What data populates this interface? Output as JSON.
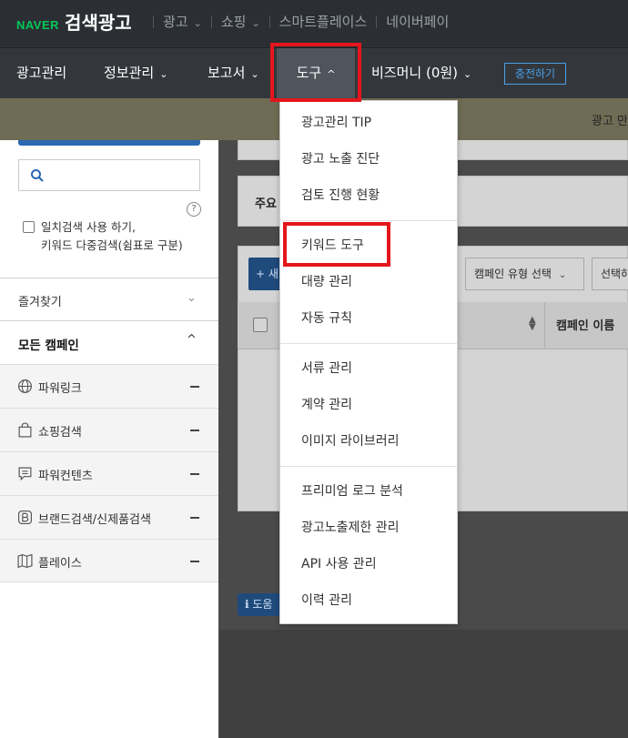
{
  "header": {
    "brand_naver": "NAVER",
    "brand_title": "검색광고",
    "top_links": [
      {
        "label": "광고",
        "has_chevron": true
      },
      {
        "label": "쇼핑",
        "has_chevron": true
      },
      {
        "label": "스마트플레이스",
        "has_chevron": false
      },
      {
        "label": "네이버페이",
        "has_chevron": false
      }
    ]
  },
  "nav": {
    "items": [
      {
        "label": "광고관리",
        "chevron": ""
      },
      {
        "label": "정보관리",
        "chevron": "⌄"
      },
      {
        "label": "보고서",
        "chevron": "⌄"
      },
      {
        "label": "도구",
        "chevron": "^"
      },
      {
        "label": "비즈머니 (0원)",
        "chevron": "⌄"
      }
    ],
    "charge_button": "충전하기"
  },
  "notice": {
    "text": "광고 만"
  },
  "sidebar": {
    "exact_search_label_line1": "일치검색 사용 하기,",
    "exact_search_label_line2": "키워드 다중검색(쉼표로 구분)",
    "help_glyph": "?",
    "favorites_label": "즐겨찾기",
    "all_campaigns_label": "모든 캠페인",
    "campaign_types": [
      {
        "label": "파워링크",
        "icon": "globe-icon"
      },
      {
        "label": "쇼핑검색",
        "icon": "shopping-bag-icon"
      },
      {
        "label": "파워컨텐츠",
        "icon": "content-icon"
      },
      {
        "label": "브랜드검색/신제품검색",
        "icon": "brand-b-icon"
      },
      {
        "label": "플레이스",
        "icon": "map-icon"
      }
    ]
  },
  "main": {
    "key_label": "주요",
    "add_button": "+ 새",
    "filter_campaign_type": "캠페인 유형 선택",
    "filter_select": "선택하",
    "col_campaign_name": "캠페인 이름",
    "help_button": "ℹ 도움"
  },
  "tools_menu": {
    "groups": [
      [
        "광고관리 TIP",
        "광고 노출 진단",
        "검토 진행 현황"
      ],
      [
        "키워드 도구",
        "대량 관리",
        "자동 규칙"
      ],
      [
        "서류 관리",
        "계약 관리",
        "이미지 라이브러리"
      ],
      [
        "프리미엄 로그 분석",
        "광고노출제한 관리",
        "API 사용 관리",
        "이력 관리"
      ]
    ]
  },
  "colors": {
    "naver_green": "#03c75a",
    "highlight_red": "#e4161c",
    "accent_blue": "#2a69b2"
  }
}
